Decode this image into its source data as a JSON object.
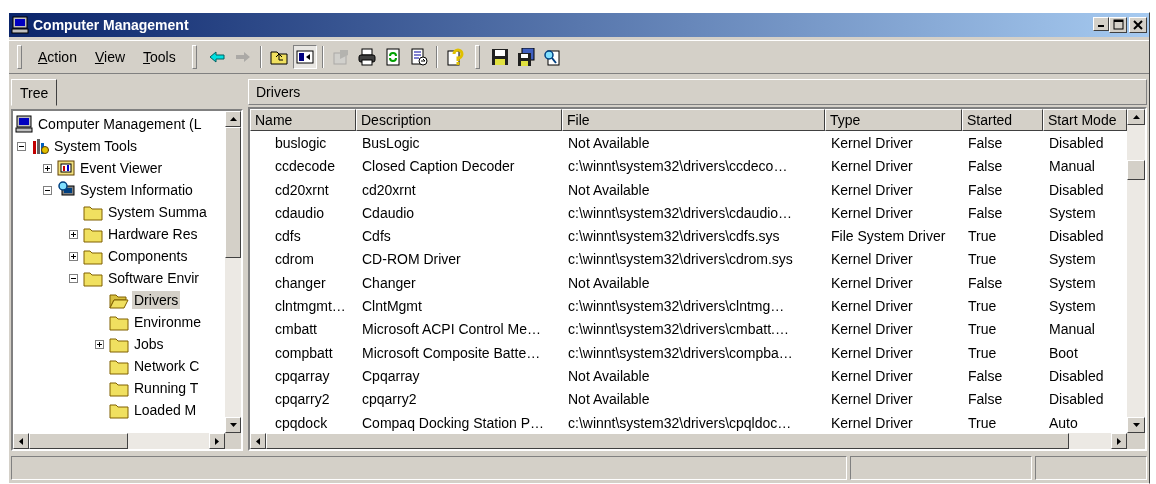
{
  "window": {
    "title": "Computer Management"
  },
  "menu": [
    {
      "label": "Action"
    },
    {
      "label": "View"
    },
    {
      "label": "Tools"
    }
  ],
  "toolbar": [
    {
      "kind": "back",
      "disabled": false,
      "pressed": false
    },
    {
      "kind": "forward",
      "disabled": true,
      "pressed": false
    },
    {
      "kind": "sep"
    },
    {
      "kind": "up-folder",
      "disabled": false,
      "pressed": false
    },
    {
      "kind": "tree-toggle",
      "disabled": false,
      "pressed": true
    },
    {
      "kind": "sep"
    },
    {
      "kind": "properties",
      "disabled": true,
      "pressed": false
    },
    {
      "kind": "print",
      "disabled": false,
      "pressed": false
    },
    {
      "kind": "refresh",
      "disabled": false,
      "pressed": false
    },
    {
      "kind": "export",
      "disabled": false,
      "pressed": false
    },
    {
      "kind": "sep"
    },
    {
      "kind": "help",
      "disabled": false,
      "pressed": false
    },
    {
      "kind": "grip"
    },
    {
      "kind": "save",
      "disabled": false,
      "pressed": false
    },
    {
      "kind": "save-as",
      "disabled": false,
      "pressed": false
    },
    {
      "kind": "find",
      "disabled": false,
      "pressed": false
    }
  ],
  "tabs": [
    {
      "label": "Tree",
      "selected": true
    }
  ],
  "tree": [
    {
      "label": "Computer Management (L",
      "kind": "computer",
      "selected": false,
      "children": [
        {
          "label": "System Tools",
          "kind": "tools",
          "selected": false,
          "expanded": true,
          "children": [
            {
              "label": "Event Viewer",
              "kind": "event",
              "selected": false,
              "expanded": false
            },
            {
              "label": "System Informatio",
              "kind": "sysinfo",
              "selected": false,
              "expanded": true,
              "children": [
                {
                  "label": "System Summa",
                  "kind": "folder",
                  "selected": false
                },
                {
                  "label": "Hardware Res",
                  "kind": "folder",
                  "selected": false,
                  "expanded": false
                },
                {
                  "label": "Components",
                  "kind": "folder",
                  "selected": false,
                  "expanded": false
                },
                {
                  "label": "Software Envir",
                  "kind": "folder",
                  "selected": false,
                  "expanded": true,
                  "children": [
                    {
                      "label": "Drivers",
                      "kind": "open-folder",
                      "selected": true
                    },
                    {
                      "label": "Environme",
                      "kind": "folder",
                      "selected": false
                    },
                    {
                      "label": "Jobs",
                      "kind": "folder",
                      "selected": false,
                      "expanded": false
                    },
                    {
                      "label": "Network C",
                      "kind": "folder",
                      "selected": false
                    },
                    {
                      "label": "Running T",
                      "kind": "folder",
                      "selected": false
                    },
                    {
                      "label": "Loaded M",
                      "kind": "folder",
                      "selected": false
                    }
                  ]
                }
              ]
            }
          ]
        }
      ]
    }
  ],
  "list": {
    "title": "Drivers",
    "columns": [
      "Name",
      "Description",
      "File",
      "Type",
      "Started",
      "Start Mode"
    ],
    "rows": [
      [
        "buslogic",
        "BusLogic",
        "Not Available",
        "Kernel Driver",
        "False",
        "Disabled"
      ],
      [
        "ccdecode",
        "Closed Caption Decoder",
        "c:\\winnt\\system32\\drivers\\ccdeco…",
        "Kernel Driver",
        "False",
        "Manual"
      ],
      [
        "cd20xrnt",
        "cd20xrnt",
        "Not Available",
        "Kernel Driver",
        "False",
        "Disabled"
      ],
      [
        "cdaudio",
        "Cdaudio",
        "c:\\winnt\\system32\\drivers\\cdaudio…",
        "Kernel Driver",
        "False",
        "System"
      ],
      [
        "cdfs",
        "Cdfs",
        "c:\\winnt\\system32\\drivers\\cdfs.sys",
        "File System Driver",
        "True",
        "Disabled"
      ],
      [
        "cdrom",
        "CD-ROM Driver",
        "c:\\winnt\\system32\\drivers\\cdrom.sys",
        "Kernel Driver",
        "True",
        "System"
      ],
      [
        "changer",
        "Changer",
        "Not Available",
        "Kernel Driver",
        "False",
        "System"
      ],
      [
        "clntmgmt…",
        "ClntMgmt",
        "c:\\winnt\\system32\\drivers\\clntmg…",
        "Kernel Driver",
        "True",
        "System"
      ],
      [
        "cmbatt",
        "Microsoft ACPI Control Me…",
        "c:\\winnt\\system32\\drivers\\cmbatt.…",
        "Kernel Driver",
        "True",
        "Manual"
      ],
      [
        "compbatt",
        "Microsoft Composite Batte…",
        "c:\\winnt\\system32\\drivers\\compba…",
        "Kernel Driver",
        "True",
        "Boot"
      ],
      [
        "cpqarray",
        "Cpqarray",
        "Not Available",
        "Kernel Driver",
        "False",
        "Disabled"
      ],
      [
        "cpqarry2",
        "cpqarry2",
        "Not Available",
        "Kernel Driver",
        "False",
        "Disabled"
      ],
      [
        "cpqdock",
        "Compaq Docking Station P…",
        "c:\\winnt\\system32\\drivers\\cpqldoc…",
        "Kernel Driver",
        "True",
        "Auto"
      ]
    ]
  }
}
